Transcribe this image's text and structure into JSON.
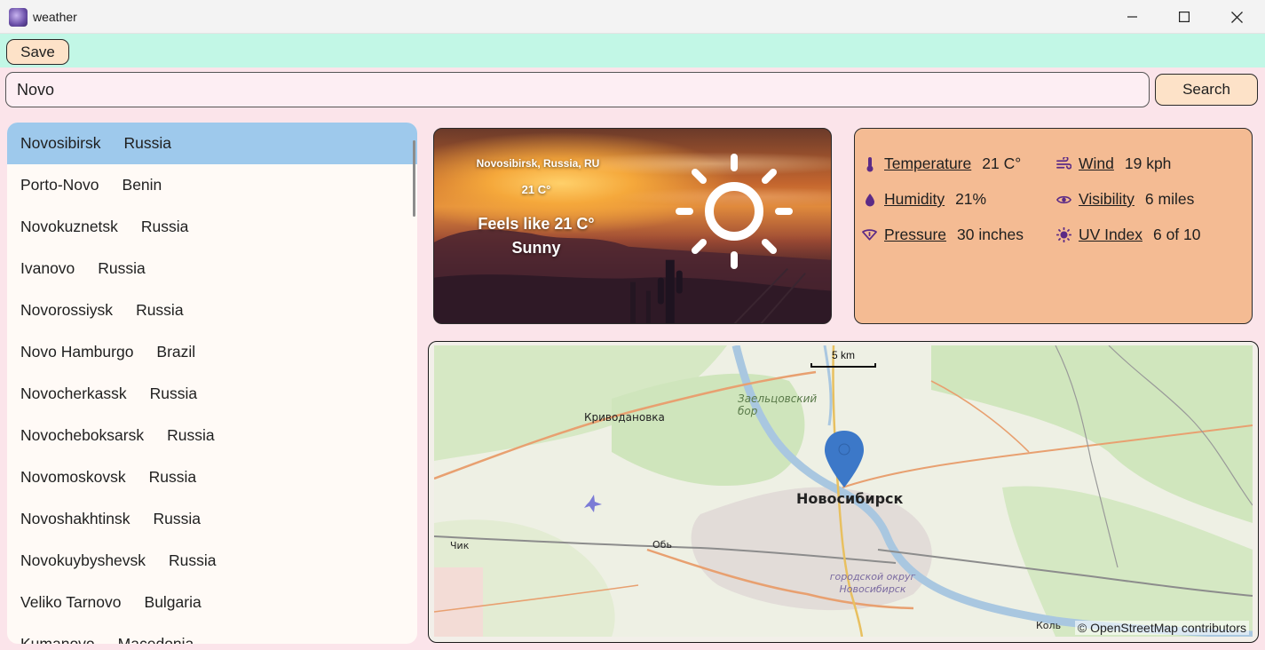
{
  "window": {
    "title": "weather",
    "controls": [
      "minimize",
      "maximize",
      "close"
    ]
  },
  "toolbar": {
    "save_label": "Save"
  },
  "search": {
    "value": "Novo",
    "button_label": "Search"
  },
  "cities": [
    {
      "name": "Novosibirsk",
      "country": "Russia",
      "selected": true
    },
    {
      "name": "Porto-Novo",
      "country": "Benin"
    },
    {
      "name": "Novokuznetsk",
      "country": "Russia"
    },
    {
      "name": "Ivanovo",
      "country": "Russia"
    },
    {
      "name": "Novorossiysk",
      "country": "Russia"
    },
    {
      "name": "Novo Hamburgo",
      "country": "Brazil"
    },
    {
      "name": "Novocherkassk",
      "country": "Russia"
    },
    {
      "name": "Novocheboksarsk",
      "country": "Russia"
    },
    {
      "name": "Novomoskovsk",
      "country": "Russia"
    },
    {
      "name": "Novoshakhtinsk",
      "country": "Russia"
    },
    {
      "name": "Novokuybyshevsk",
      "country": "Russia"
    },
    {
      "name": "Veliko Tarnovo",
      "country": "Bulgaria"
    },
    {
      "name": "Kumanovo",
      "country": "Macedonia"
    }
  ],
  "weather": {
    "location": "Novosibirsk, Russia, RU",
    "temperature": "21 C°",
    "feels_like": "Feels like 21 C°",
    "condition": "Sunny",
    "condition_icon": "sun-icon"
  },
  "details": {
    "temperature": {
      "label": "Temperature",
      "value": "21 C°",
      "icon": "thermometer-icon"
    },
    "wind": {
      "label": "Wind",
      "value": "19 kph",
      "icon": "wind-icon"
    },
    "humidity": {
      "label": "Humidity",
      "value": "21%",
      "icon": "droplet-icon"
    },
    "visibility": {
      "label": "Visibility",
      "value": "6 miles",
      "icon": "eye-icon"
    },
    "pressure": {
      "label": "Pressure",
      "value": "30 inches",
      "icon": "pressure-icon"
    },
    "uv_index": {
      "label": "UV Index",
      "value": "6 of 10",
      "icon": "uv-sun-icon"
    }
  },
  "map": {
    "scale_label": "5 km",
    "attribution": "© OpenStreetMap contributors",
    "labels": {
      "city": "Новосибирск",
      "krivodanovka": "Криводановка",
      "forest": "Заельцовский бор",
      "ob": "Обь",
      "chik": "Чик",
      "district": "городской округ Новосибирск",
      "kol": "Коль"
    }
  },
  "colors": {
    "toolbar_bg": "#c2f7e6",
    "body_bg": "#fbe4ea",
    "button_bg": "#fde2c8",
    "selected_row": "#9ec9ec",
    "details_bg": "#f4bb93",
    "icon_accent": "#5b2a86",
    "map_marker": "#3c78c8"
  }
}
